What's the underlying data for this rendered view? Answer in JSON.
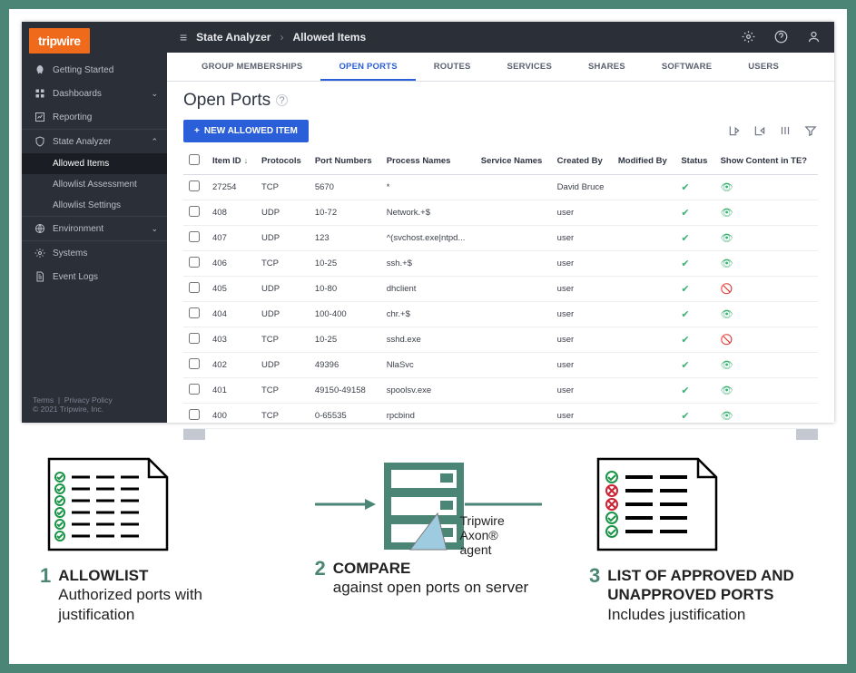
{
  "brand": "tripwire",
  "footer": {
    "terms": "Terms",
    "privacy": "Privacy Policy",
    "copyright": "© 2021 Tripwire, Inc."
  },
  "breadcrumb": {
    "root": "State Analyzer",
    "current": "Allowed Items"
  },
  "sidebar": {
    "items": [
      {
        "label": "Getting Started",
        "icon": "rocket"
      },
      {
        "label": "Dashboards",
        "icon": "grid",
        "chev": "v"
      },
      {
        "label": "Reporting",
        "icon": "report"
      }
    ],
    "analyzer": {
      "label": "State Analyzer",
      "subs": [
        {
          "label": "Allowed Items",
          "active": true
        },
        {
          "label": "Allowlist Assessment"
        },
        {
          "label": "Allowlist Settings"
        }
      ]
    },
    "env": {
      "label": "Environment"
    },
    "systems": {
      "label": "Systems"
    },
    "logs": {
      "label": "Event Logs"
    }
  },
  "tabs": [
    "GROUP MEMBERSHIPS",
    "OPEN PORTS",
    "ROUTES",
    "SERVICES",
    "SHARES",
    "SOFTWARE",
    "USERS"
  ],
  "activeTabIndex": 1,
  "page_title": "Open Ports",
  "new_btn": "NEW ALLOWED ITEM",
  "columns": {
    "item_id": "Item ID",
    "protocols": "Protocols",
    "port_numbers": "Port Numbers",
    "process_names": "Process Names",
    "service_names": "Service Names",
    "created_by": "Created By",
    "modified_by": "Modified By",
    "status": "Status",
    "show_content": "Show Content in TE?"
  },
  "rows": [
    {
      "id": "27254",
      "proto": "TCP",
      "ports": "5670",
      "proc": "*",
      "svc": "",
      "created": "David Bruce",
      "mod": "",
      "status": "ok",
      "show": true
    },
    {
      "id": "408",
      "proto": "UDP",
      "ports": "10-72",
      "proc": "Network.+$",
      "svc": "",
      "created": "user",
      "mod": "",
      "status": "ok",
      "show": true
    },
    {
      "id": "407",
      "proto": "UDP",
      "ports": "123",
      "proc": "^(svchost.exe|ntpd...",
      "svc": "",
      "created": "user",
      "mod": "",
      "status": "ok",
      "show": true
    },
    {
      "id": "406",
      "proto": "TCP",
      "ports": "10-25",
      "proc": "ssh.+$",
      "svc": "",
      "created": "user",
      "mod": "",
      "status": "ok",
      "show": true
    },
    {
      "id": "405",
      "proto": "UDP",
      "ports": "10-80",
      "proc": "dhclient",
      "svc": "",
      "created": "user",
      "mod": "",
      "status": "ok",
      "show": false
    },
    {
      "id": "404",
      "proto": "UDP",
      "ports": "100-400",
      "proc": "chr.+$",
      "svc": "",
      "created": "user",
      "mod": "",
      "status": "ok",
      "show": true
    },
    {
      "id": "403",
      "proto": "TCP",
      "ports": "10-25",
      "proc": "sshd.exe",
      "svc": "",
      "created": "user",
      "mod": "",
      "status": "ok",
      "show": false
    },
    {
      "id": "402",
      "proto": "UDP",
      "ports": "49396",
      "proc": "NlaSvc",
      "svc": "",
      "created": "user",
      "mod": "",
      "status": "ok",
      "show": true
    },
    {
      "id": "401",
      "proto": "TCP",
      "ports": "49150-49158",
      "proc": "spoolsv.exe",
      "svc": "",
      "created": "user",
      "mod": "",
      "status": "ok",
      "show": true
    },
    {
      "id": "400",
      "proto": "TCP",
      "ports": "0-65535",
      "proc": "rpcbind",
      "svc": "",
      "created": "user",
      "mod": "",
      "status": "ok",
      "show": true
    }
  ],
  "diagram": {
    "axon": "Tripwire Axon®\nagent",
    "steps": [
      {
        "n": "1",
        "title": "ALLOWLIST",
        "body": "Authorized ports with justification"
      },
      {
        "n": "2",
        "title": "COMPARE",
        "body": "against open ports on server"
      },
      {
        "n": "3",
        "title": "LIST OF APPROVED AND UNAPPROVED PORTS",
        "body": "Includes justification"
      }
    ]
  }
}
